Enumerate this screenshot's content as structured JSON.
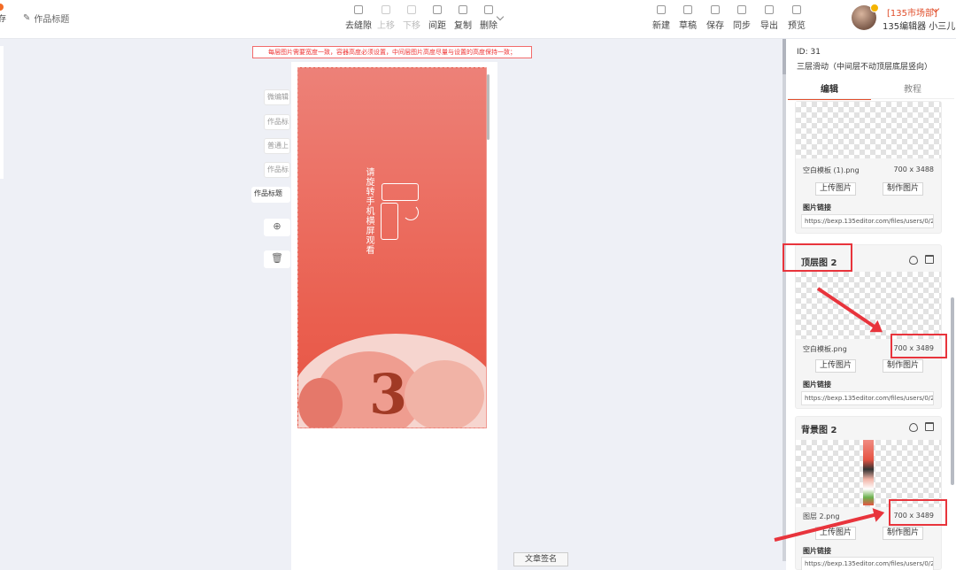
{
  "app": {
    "logo_glyph": "存",
    "doc_title": "作品标题"
  },
  "toolbar": {
    "center": [
      {
        "label": "去缝隙",
        "disabled": false
      },
      {
        "label": "上移",
        "disabled": true
      },
      {
        "label": "下移",
        "disabled": true
      },
      {
        "label": "间距",
        "disabled": false
      },
      {
        "label": "复制",
        "disabled": false
      },
      {
        "label": "删除",
        "disabled": false
      }
    ],
    "right": [
      "新建",
      "草稿",
      "保存",
      "同步",
      "导出",
      "预览"
    ]
  },
  "user": {
    "market": "[135市场部]",
    "name": "135编辑器 小三儿"
  },
  "canvas": {
    "notice": "每层图片需要宽度一致，容器高度必须设置，中间层图片高度尽量与设置的高度保持一致；",
    "art_text": "请旋转手机横屏观看",
    "art_number": "3",
    "side_labels": [
      "微编辑",
      "作品标",
      "普通上",
      "作品标",
      "作品标题"
    ],
    "add_symbol": "⊕",
    "delete_symbol": "🗑",
    "sign_button": "文章签名"
  },
  "panel": {
    "id_text": "ID: 31",
    "title": "三层滑动（中间层不动顶层底层竖向）",
    "tabs": [
      "编辑",
      "教程"
    ],
    "cards": [
      {
        "header": "",
        "file": "空白模板 (1).png",
        "size": "700 x 3488",
        "upload": "上传图片",
        "make": "制作图片",
        "link_label": "图片链接",
        "url": "https://bexp.135editor.com/files/users/0/2/2("
      },
      {
        "header": "顶层图 2",
        "file": "空白模板.png",
        "size": "700 x 3489",
        "upload": "上传图片",
        "make": "制作图片",
        "link_label": "图片链接",
        "url": "https://bexp.135editor.com/files/users/0/2/2("
      },
      {
        "header": "背景图 2",
        "file": "图层 2.png",
        "size": "700 x 3489",
        "upload": "上传图片",
        "make": "制作图片",
        "link_label": "图片链接",
        "url": "https://bexp.135editor.com/files/users/0/2/2("
      }
    ]
  },
  "colors": {
    "accent": "#e04d2a",
    "highlight": "#e8343c",
    "art_top": "#ed8178",
    "art_bottom": "#e65444"
  }
}
